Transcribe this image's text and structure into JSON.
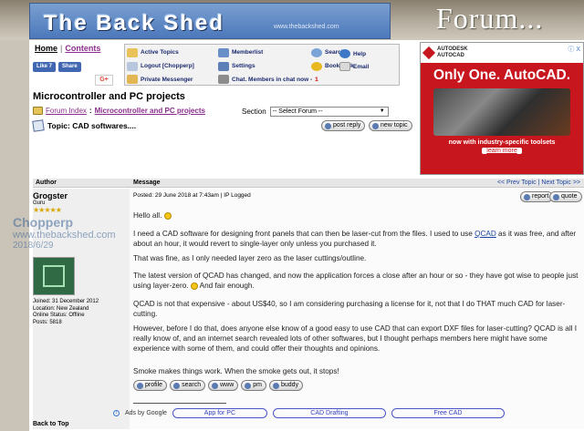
{
  "banner": {
    "title": "The Back Shed",
    "url": "www.thebackshed.com",
    "forum": "Forum..."
  },
  "topnav": {
    "home": "Home",
    "contents": "Contents"
  },
  "social": {
    "like": "Like 7",
    "share": "Share",
    "gplus": "G+"
  },
  "menu": {
    "active_topics": "Active Topics",
    "memberlist": "Memberlist",
    "search": "Search",
    "help": "Help",
    "logout": "Logout [Chopperp]",
    "settings": "Settings",
    "bookmark": "Bookmark",
    "email": "Email",
    "private_messenger": "Private Messenger",
    "chat": "Chat. Members in chat now - ",
    "chat_count": "1"
  },
  "ad": {
    "brand_line1": "AUTODESK",
    "brand_line2": "AUTOCAD",
    "headline": "Only One. AutoCAD.",
    "sub": "now with industry-specific toolsets",
    "button": "learn more",
    "close": "ⓘ X",
    "color": "#c8161e"
  },
  "page": {
    "title": "Microcontroller and PC projects",
    "forum_index": "Forum Index",
    "sep": " : ",
    "crumb_forum": "Microcontroller and PC projects",
    "section_label": "Section",
    "section_select": "-- Select Forum --",
    "topic": "Topic: CAD softwares....",
    "post_reply": "post reply",
    "new_topic": "new topic"
  },
  "table": {
    "col_author": "Author",
    "col_message": "Message",
    "nav": "<< Prev Topic | Next Topic >>"
  },
  "post": {
    "author": "Grogster",
    "rank": "Guru",
    "stars": "★★★★★",
    "joined": "Joined: 31 December 2012",
    "location": "Location: New Zealand",
    "status": "Online Status: Offline",
    "posts": "Posts: 5818",
    "posted": "Posted: 29 June 2018 at 7:43am | IP Logged",
    "report": "report",
    "quote": "quote",
    "p1": "Hello all.",
    "p2a": "I need a CAD software for designing front panels that can then be laser-cut from the files. I used to use ",
    "p2link": "QCAD",
    "p2b": " as it was free, and after about an hour, it would revert to single-layer only unless you purchased it.",
    "p3": "That was fine, as I only needed layer zero as the laser cuttings/outline.",
    "p4a": "The latest version of QCAD has changed, and now the application forces a close after an hour or so - they have got wise to people just using layer-zero. ",
    "p4b": " And fair enough.",
    "p5": "QCAD is not that expensive - about US$40, so I am considering purchasing a license for it, not that I do THAT much CAD for laser-cutting.",
    "p6": "However, before I do that, does anyone else know of a good easy to use CAD that can export DXF files for laser-cutting? QCAD is all I really know of, and an internet search revealed lots of other softwares, but I thought perhaps members here might have some experience with some of them, and could offer their thoughts and opinions.",
    "sig": "Smoke makes things work. When the smoke gets out, it stops!",
    "back_to_top": "Back to Top",
    "btn_profile": "profile",
    "btn_search": "search",
    "btn_www": "www",
    "btn_pm": "pm",
    "btn_buddy": "buddy"
  },
  "adbar": {
    "ads_by": "Ads by Google",
    "pill1": "App for PC",
    "pill2": "CAD Drafting",
    "pill3": "Free CAD"
  },
  "watermark": {
    "line1": "Chopperp",
    "line2": "www.thebackshed.com",
    "line3": "2018/6/29"
  }
}
